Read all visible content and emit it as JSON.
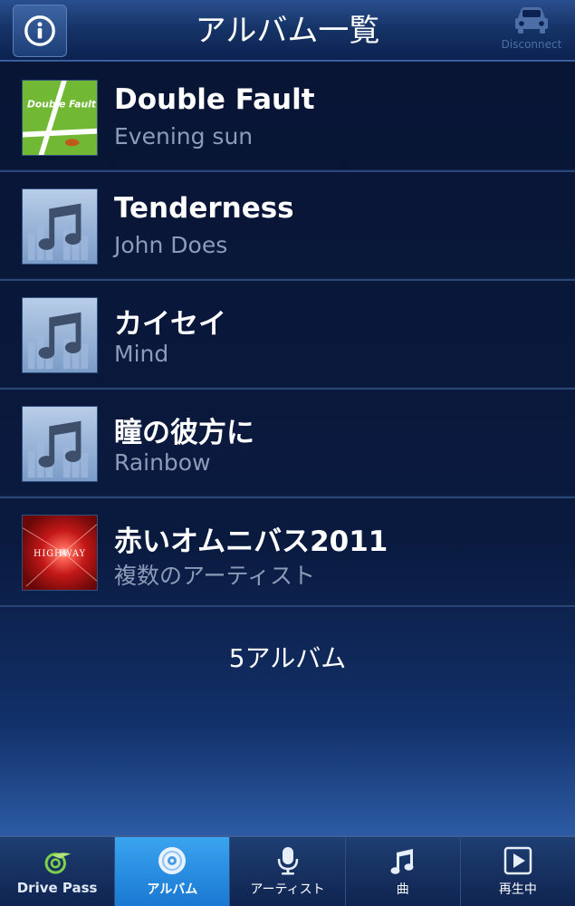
{
  "header": {
    "title": "アルバム一覧",
    "info_icon": "info-icon",
    "disconnect_label": "Disconnect",
    "disconnect_icon": "car-icon"
  },
  "albums": [
    {
      "title": "Double Fault",
      "artist": "Evening sun",
      "cover": "double-fault-cover",
      "cover_text": "Double Fault"
    },
    {
      "title": "Tenderness",
      "artist": "John Does",
      "cover": "music-note-placeholder"
    },
    {
      "title": "カイセイ",
      "artist": "Mind",
      "cover": "music-note-placeholder"
    },
    {
      "title": "瞳の彼方に",
      "artist": "Rainbow",
      "cover": "music-note-placeholder"
    },
    {
      "title": "赤いオムニバス2011",
      "artist": "複数のアーティスト",
      "cover": "highway-cover",
      "cover_text": "HIGHWAY"
    }
  ],
  "album_count": "5アルバム",
  "tabbar": {
    "tabs": [
      {
        "label": "Drive Pass",
        "icon": "drive-pass-logo",
        "active": false
      },
      {
        "label": "アルバム",
        "icon": "disc-icon",
        "active": true
      },
      {
        "label": "アーティスト",
        "icon": "microphone-icon",
        "active": false
      },
      {
        "label": "曲",
        "icon": "music-note-icon",
        "active": false
      },
      {
        "label": "再生中",
        "icon": "play-icon",
        "active": false
      }
    ]
  },
  "colors": {
    "accent": "#1a78d2",
    "background": "#0a1a3f",
    "subtitle": "#8c9cb8"
  }
}
